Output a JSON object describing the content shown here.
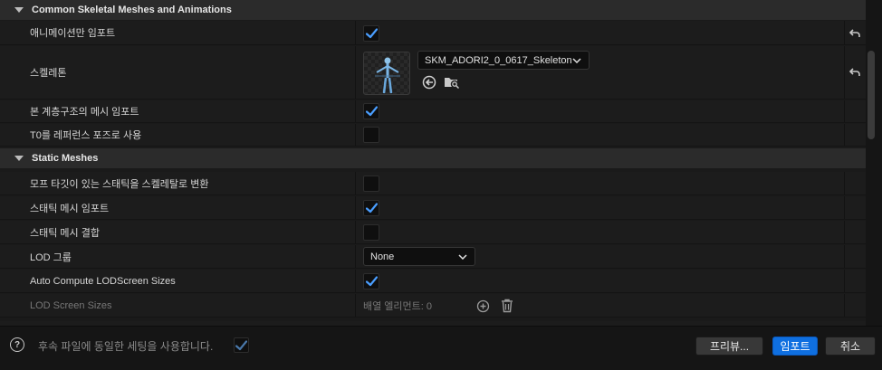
{
  "sections": {
    "common": {
      "title": "Common Skeletal Meshes and Animations"
    },
    "static": {
      "title": "Static Meshes"
    }
  },
  "rows": {
    "anim_only": {
      "label": "애니메이션만 임포트",
      "checked": true
    },
    "skeleton": {
      "label": "스켈레톤",
      "value": "SKM_ADORI2_0_0617_Skeleton"
    },
    "import_bone_hierarchy": {
      "label": "본 계층구조의 메시 임포트",
      "checked": true
    },
    "t0_reference_pose": {
      "label": "T0를 레퍼런스 포즈로 사용",
      "checked": false
    },
    "convert_morph_static": {
      "label": "모프 타깃이 있는 스태틱을 스켈레탈로 변환",
      "checked": false
    },
    "import_static_mesh": {
      "label": "스태틱 메시 임포트",
      "checked": true
    },
    "combine_static_mesh": {
      "label": "스태틱 메시 결합",
      "checked": false
    },
    "lod_group": {
      "label": "LOD 그룹",
      "value": "None"
    },
    "auto_compute_lod": {
      "label": "Auto Compute LODScreen Sizes",
      "checked": true
    },
    "lod_screen_sizes": {
      "label": "LOD Screen Sizes",
      "value": "배열 엘리먼트: 0"
    }
  },
  "icons": {
    "section_toggle": "triangle-down-icon",
    "reset": "reset-arrow-icon",
    "skeleton_use": "arrow-left-circle-icon",
    "skeleton_browse": "folder-search-icon",
    "array_add": "plus-circle-icon",
    "array_delete": "trash-icon",
    "help": "question-circle-icon",
    "checkmark": "checkmark-icon"
  },
  "footer": {
    "help_glyph": "?",
    "use_same_settings": {
      "label": "후속 파일에 동일한 세팅을 사용합니다.",
      "checked": true
    },
    "preview_button": "프리뷰...",
    "import_button": "임포트",
    "cancel_button": "취소"
  },
  "colors": {
    "accent": "#0f6fe0",
    "check": "#4a9eff",
    "section_bg": "#2b2b2b",
    "row_bg": "#1c1c1c"
  }
}
